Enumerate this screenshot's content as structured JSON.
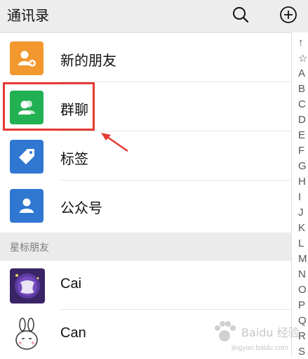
{
  "header": {
    "title": "通讯录",
    "search_icon": "search-icon",
    "add_icon": "plus-circle-icon"
  },
  "menu": [
    {
      "key": "new-friends",
      "label": "新的朋友",
      "icon": "person-add-icon",
      "color": "#f2982f"
    },
    {
      "key": "group-chat",
      "label": "群聊",
      "icon": "group-icon",
      "color": "#21b052"
    },
    {
      "key": "tags",
      "label": "标签",
      "icon": "tag-icon",
      "color": "#2f77d1"
    },
    {
      "key": "official-accounts",
      "label": "公众号",
      "icon": "person-icon",
      "color": "#2f77d1"
    }
  ],
  "section": {
    "label": "星标朋友"
  },
  "friends": [
    {
      "name": "Cai"
    },
    {
      "name": "Can"
    }
  ],
  "index": [
    "↑",
    "☆",
    "A",
    "B",
    "C",
    "D",
    "E",
    "F",
    "G",
    "H",
    "I",
    "J",
    "K",
    "L",
    "M",
    "N",
    "O",
    "P",
    "Q",
    "R",
    "S"
  ],
  "annotation": {
    "highlight_color": "#e53935"
  },
  "watermark": {
    "text": "Baidu 经验",
    "subtext": "jingyan.baidu.com"
  }
}
